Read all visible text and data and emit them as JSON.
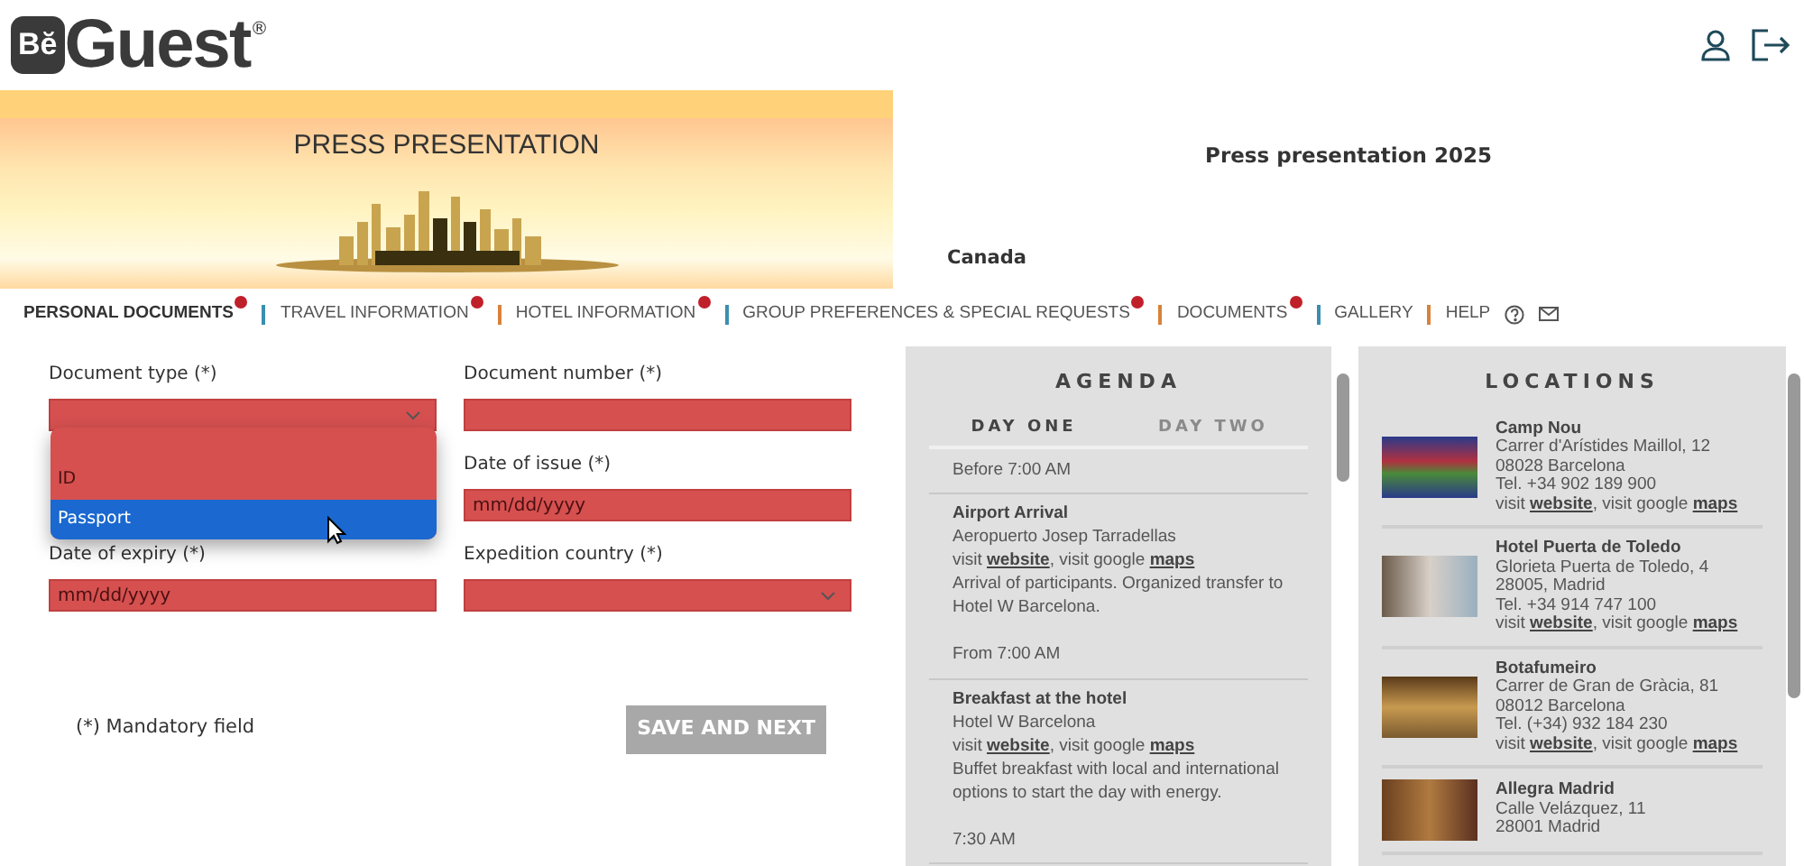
{
  "header": {
    "logo_mark": "Bĕ",
    "logo_text": "Guest",
    "logo_registered": "®"
  },
  "banner": {
    "title": "PRESS PRESENTATION"
  },
  "event": {
    "title": "Press presentation 2025",
    "country": "Canada"
  },
  "nav": {
    "items": [
      {
        "label": "PERSONAL DOCUMENTS",
        "selected": true,
        "badge": true
      },
      {
        "label": "TRAVEL INFORMATION",
        "selected": false,
        "badge": true
      },
      {
        "label": "HOTEL INFORMATION",
        "selected": false,
        "badge": true
      },
      {
        "label": "GROUP PREFERENCES & SPECIAL REQUESTS",
        "selected": false,
        "badge": true
      },
      {
        "label": "DOCUMENTS",
        "selected": false,
        "badge": true
      },
      {
        "label": "GALLERY",
        "selected": false,
        "badge": false
      },
      {
        "label": "HELP",
        "selected": false,
        "badge": false
      }
    ]
  },
  "form": {
    "fields": [
      {
        "label": "Document type (*)",
        "kind": "select"
      },
      {
        "label": "Document number (*)",
        "kind": "text"
      },
      {
        "label": "Date of issue (*)",
        "kind": "date",
        "placeholder": "mm/dd/yyyy"
      },
      {
        "label": "Date of expiry (*)",
        "kind": "date",
        "placeholder": "mm/dd/yyyy"
      },
      {
        "label": "Expedition country (*)",
        "kind": "select"
      }
    ],
    "dropdown": {
      "options": [
        {
          "label": "ID",
          "selected": false
        },
        {
          "label": "Passport",
          "selected": true
        }
      ]
    },
    "note": "(*) Mandatory field",
    "submit": {
      "label": "SAVE AND NEXT",
      "disabled": true
    }
  },
  "agenda": {
    "title": "AGENDA",
    "tabs": [
      {
        "label": "DAY ONE",
        "selected": true
      },
      {
        "label": "DAY TWO",
        "selected": false
      }
    ],
    "entries": [
      {
        "time": "Before 7:00 AM",
        "title": "Airport Arrival",
        "place": "Aeropuerto Josep Tarradellas",
        "visit": "visit",
        "website": "website",
        "google": ", visit google",
        "maps": "maps",
        "description": "Arrival of participants. Organized transfer to Hotel W Barcelona."
      },
      {
        "time": "From 7:00 AM",
        "title": "Breakfast at the hotel",
        "place": "Hotel W Barcelona",
        "visit": "visit",
        "website": "website",
        "google": ", visit google",
        "maps": "maps",
        "description": "Buffet breakfast with local and international options to start the day with energy."
      },
      {
        "time": "7:30 AM"
      }
    ]
  },
  "locations": {
    "title": "LOCATIONS",
    "items": [
      {
        "name": "Camp Nou",
        "lines": [
          "Carrer d'Arístides Maillol, 12",
          "08028 Barcelona",
          "Tel. +34 902 189 900"
        ],
        "visit": "visit",
        "website": "website",
        "google": ", visit google",
        "maps": "maps"
      },
      {
        "name": "Hotel Puerta de Toledo",
        "lines": [
          "Glorieta Puerta de Toledo, 4",
          "28005, Madrid",
          "Tel. +34 914 747 100"
        ],
        "visit": "visit",
        "website": "website",
        "google": ", visit google",
        "maps": "maps"
      },
      {
        "name": "Botafumeiro",
        "lines": [
          "Carrer de Gran de Gràcia, 81",
          "08012 Barcelona",
          "Tel. (+34) 932 184 230"
        ],
        "visit": "visit",
        "website": "website",
        "google": ", visit google",
        "maps": "maps"
      },
      {
        "name": "Allegra Madrid",
        "lines": [
          "Calle Velázquez, 11",
          "28001 Madrid"
        ]
      }
    ]
  }
}
